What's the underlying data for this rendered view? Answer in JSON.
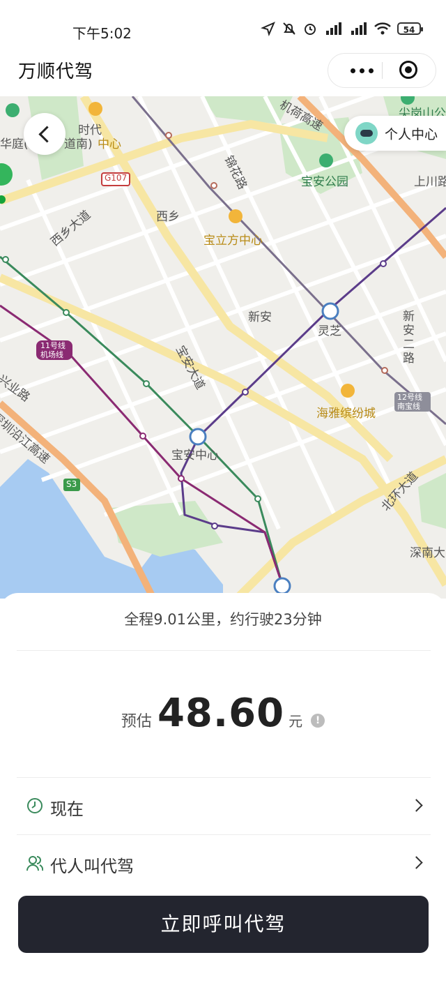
{
  "status_bar": {
    "time": "下午5:02",
    "battery": "54"
  },
  "header": {
    "title": "万顺代驾"
  },
  "map": {
    "personal_center": "个人中心",
    "labels": {
      "jianfeng_shidai": "时代",
      "zhongxin": "中心",
      "huating": "华庭(",
      "daonan": "道南)",
      "jinhua_lu": "锦花路",
      "baoan_gongyuan": "宝安公园",
      "jian_gang_shan": "尖岗山公",
      "shangchuan": "上川路",
      "xixiang": "西乡",
      "xixiang_dadao": "西乡大道",
      "baolifang": "宝立方中心",
      "xinan": "新安",
      "lingzhi": "灵芝",
      "xinan_er_lu": "新安二路",
      "baoan_dadao": "宝安大道",
      "line11": "11号线 机场线",
      "xingye_lu": "兴业路",
      "yanjiang": "深圳沿江高速",
      "haiya": "海雅缤纷城",
      "line12": "12号线 南宝线",
      "baoan_zhongxin": "宝安中心",
      "beihuan": "北环大道",
      "shennan": "深南大",
      "g107": "G107",
      "s3": "S3",
      "jihu": "机荷高速"
    }
  },
  "trip": {
    "route_info": "全程9.01公里，约行驶23分钟",
    "price_prefix": "预估",
    "price": "48.60",
    "price_unit": "元",
    "info_mark": "!"
  },
  "options": [
    {
      "label": "现在",
      "icon": "clock-icon"
    },
    {
      "label": "代人叫代驾",
      "icon": "person-icon"
    }
  ],
  "call_button": "立即呼叫代驾",
  "colors": {
    "button": "#23252f",
    "metro_green": "#3a8a5c",
    "metro_purple": "#8a2a72",
    "metro_grey": "#7a6f8c"
  }
}
